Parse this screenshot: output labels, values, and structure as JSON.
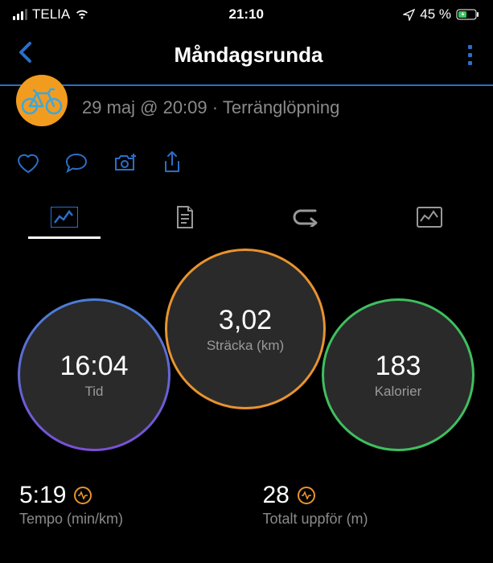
{
  "status_bar": {
    "carrier": "TELIA",
    "time": "21:10",
    "battery_pct": "45 %"
  },
  "header": {
    "title": "Måndagsrunda"
  },
  "activity": {
    "datetime": "29 maj @ 20:09",
    "separator": "·",
    "type": "Terränglöpning"
  },
  "circles": {
    "distance": {
      "value": "3,02",
      "label": "Sträcka (km)"
    },
    "time": {
      "value": "16:04",
      "label": "Tid"
    },
    "calories": {
      "value": "183",
      "label": "Kalorier"
    }
  },
  "stats": {
    "pace": {
      "value": "5:19",
      "label": "Tempo (min/km)"
    },
    "ascent": {
      "value": "28",
      "label": "Totalt uppför (m)"
    }
  }
}
